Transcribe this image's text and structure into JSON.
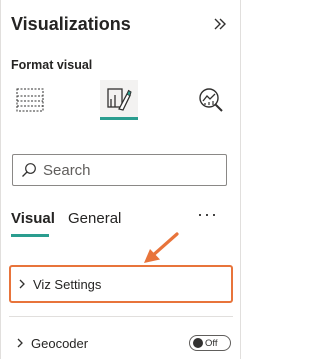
{
  "pane": {
    "title": "Visualizations",
    "subtitle": "Format visual"
  },
  "icons": {
    "collapse": "double-chevron-right-icon",
    "build_visual": "table-grid-icon",
    "format_visual": "paint-brush-icon",
    "analytics": "magnifier-chart-icon"
  },
  "search": {
    "placeholder": "Search"
  },
  "tabs": [
    {
      "label": "Visual",
      "active": true
    },
    {
      "label": "General",
      "active": false
    }
  ],
  "more_label": "···",
  "sections": [
    {
      "label": "Viz Settings",
      "highlighted": true
    },
    {
      "label": "Geocoder",
      "toggle": "Off"
    }
  ],
  "colors": {
    "accent": "#2a9d8f",
    "highlight": "#e8743b"
  }
}
